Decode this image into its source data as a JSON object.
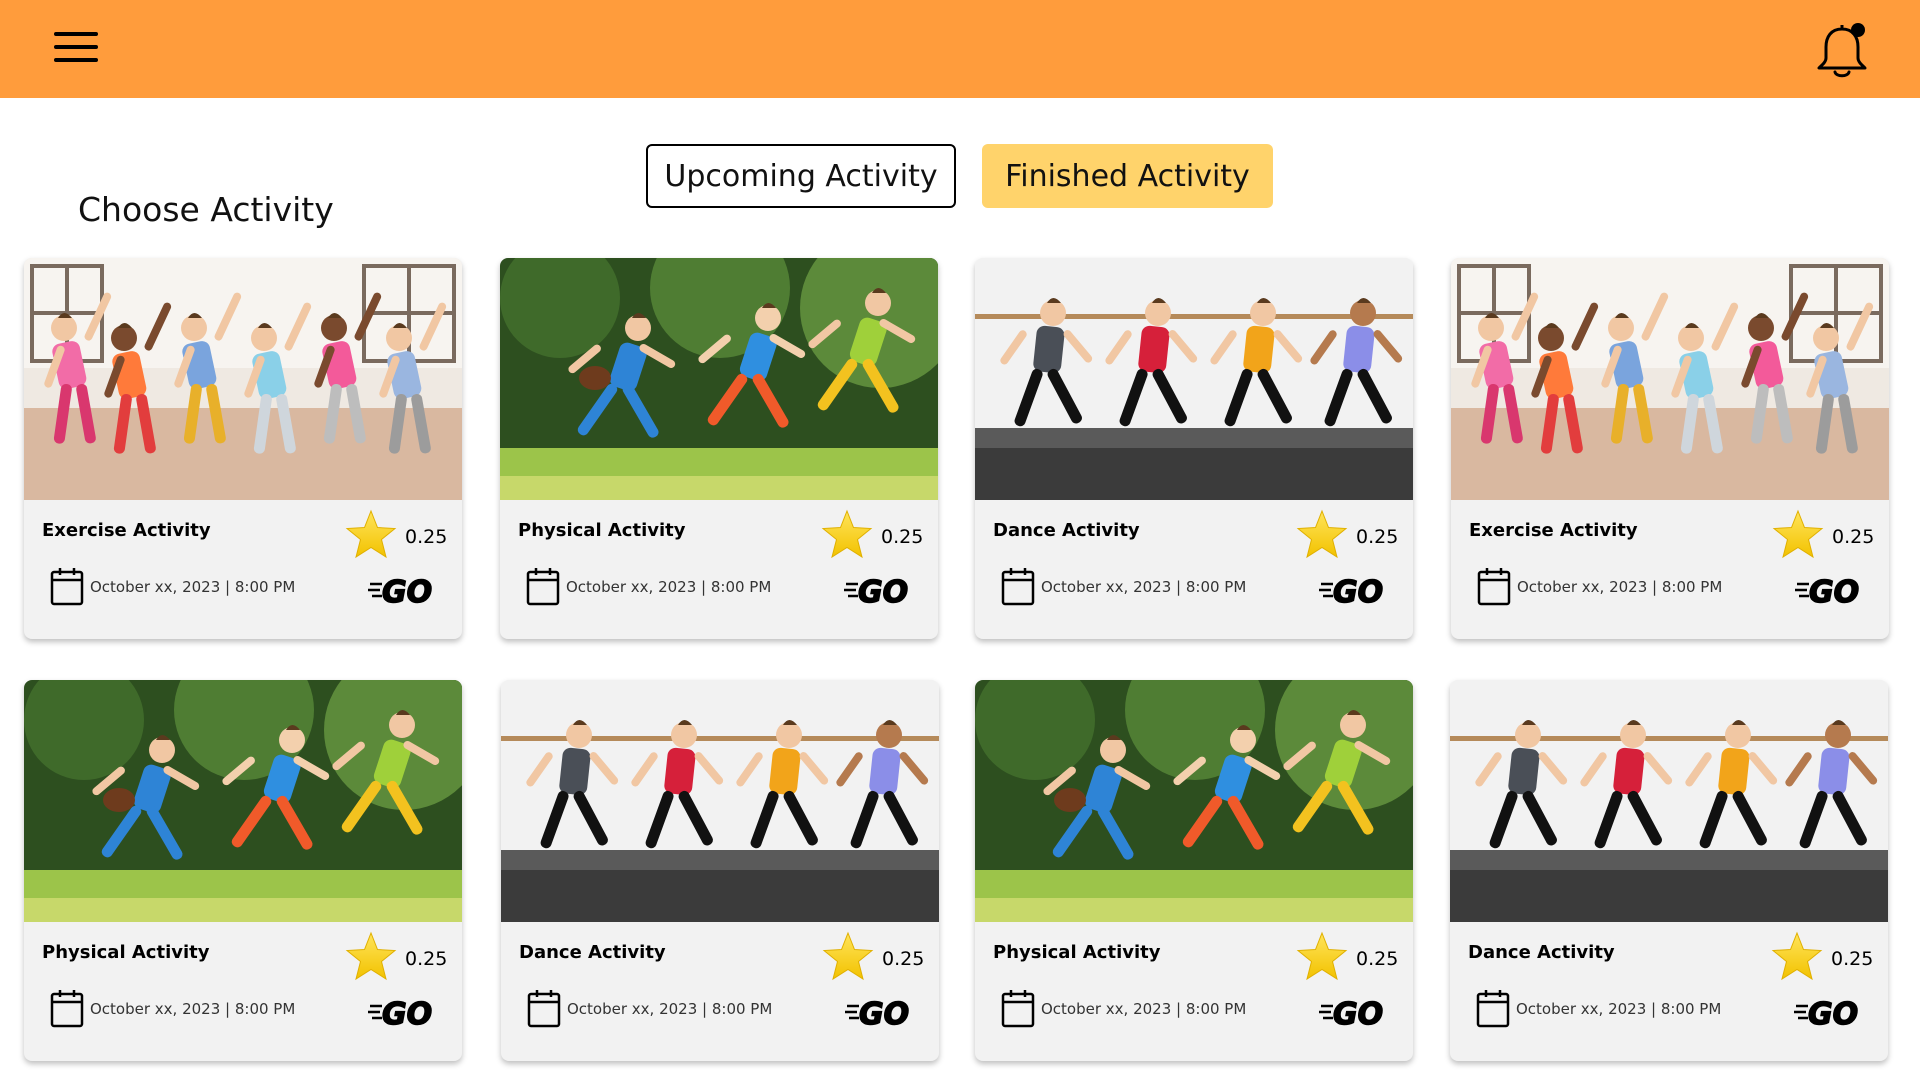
{
  "header": {
    "background_color": "#FF9C3C",
    "menu_icon": "hamburger-menu-icon",
    "notification_icon": "bell-icon",
    "notification_dot": true
  },
  "tabs": [
    {
      "label": "Upcoming Activity",
      "active": false
    },
    {
      "label": "Finished Activity",
      "active": true,
      "color": "#FFD36B"
    }
  ],
  "page_title": "Choose Activity",
  "go_label": "GO",
  "cards": [
    {
      "title": "Exercise Activity",
      "points": "0.25",
      "date": "October xx, 2023 | 8:00 PM",
      "image": "kids-stretching-photo"
    },
    {
      "title": "Physical Activity",
      "points": "0.25",
      "date": "October xx, 2023 | 8:00 PM",
      "image": "kids-running-football-photo"
    },
    {
      "title": "Dance Activity",
      "points": "0.25",
      "date": "October xx, 2023 | 8:00 PM",
      "image": "kids-dancing-photo"
    },
    {
      "title": "Exercise Activity",
      "points": "0.25",
      "date": "October xx, 2023 | 8:00 PM",
      "image": "kids-stretching-photo"
    },
    {
      "title": "Physical Activity",
      "points": "0.25",
      "date": "October xx, 2023 | 8:00 PM",
      "image": "kids-running-football-photo"
    },
    {
      "title": "Dance Activity",
      "points": "0.25",
      "date": "October xx, 2023 | 8:00 PM",
      "image": "kids-dancing-photo"
    },
    {
      "title": "Physical Activity",
      "points": "0.25",
      "date": "October xx, 2023 | 8:00 PM",
      "image": "kids-running-football-photo"
    },
    {
      "title": "Dance Activity",
      "points": "0.25",
      "date": "October xx, 2023 | 8:00 PM",
      "image": "kids-dancing-photo"
    }
  ]
}
